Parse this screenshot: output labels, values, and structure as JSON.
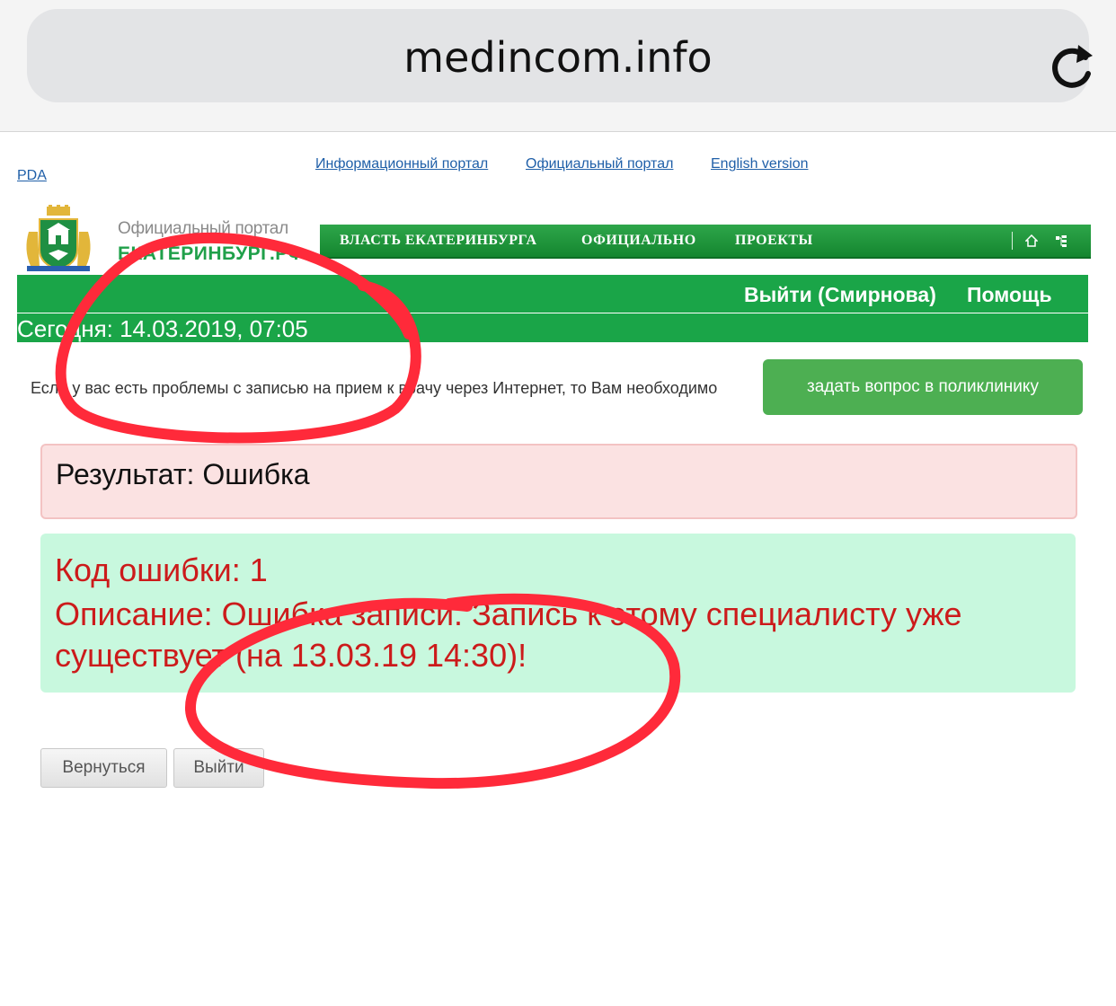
{
  "browser": {
    "url": "medincom.info"
  },
  "top_links": {
    "pda": "PDA",
    "info_portal": "Информационный портал",
    "official_portal": "Официальный портал",
    "english": "English version"
  },
  "logo": {
    "line1": "Официальный портал",
    "line2": "ЕКАТЕРИНБУРГ.РФ"
  },
  "topnav": {
    "items": [
      "ВЛАСТЬ ЕКАТЕРИНБУРГА",
      "ОФИЦИАЛЬНО",
      "ПРОЕКТЫ"
    ]
  },
  "userbar": {
    "logout": "Выйти (Смирнова)",
    "help": "Помощь"
  },
  "datebar": {
    "text": "Сегодня: 14.03.2019, 07:05"
  },
  "info": {
    "text": "Если у вас есть проблемы с записью на прием к врачу через Интернет, то Вам необходимо",
    "button": "задать вопрос в поликлинику"
  },
  "result": {
    "text": "Результат: Ошибка"
  },
  "error": {
    "code": "Код ошибки: 1",
    "desc_line1": "Описание: Ошибка записи. Запись к этому специалисту уже",
    "desc_line2": "существует (на 13.03.19 14:30)!"
  },
  "buttons": {
    "back": "Вернуться",
    "exit": "Выйти"
  },
  "colors": {
    "green": "#1aa548",
    "error_red": "#cc1b1b",
    "annotation": "#ff2a3a"
  }
}
